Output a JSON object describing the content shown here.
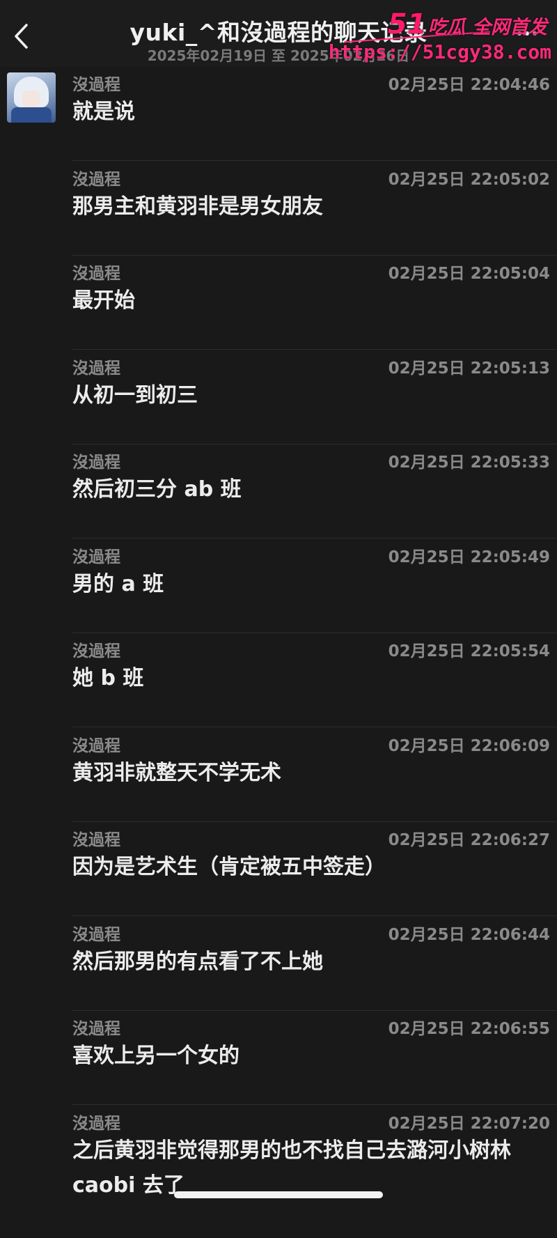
{
  "header": {
    "title": "yuki_^和沒過程的聊天记录",
    "date_range": "2025年02月19日 至 2025年02月26日"
  },
  "watermark": {
    "logo_num": "51",
    "logo_text": "吃瓜 全网首发",
    "url": "https://51cgy38.com"
  },
  "messages": [
    {
      "sender": "沒過程",
      "time": "02月25日 22:04:46",
      "text": "就是说"
    },
    {
      "sender": "沒過程",
      "time": "02月25日 22:05:02",
      "text": "那男主和黄羽非是男女朋友"
    },
    {
      "sender": "沒過程",
      "time": "02月25日 22:05:04",
      "text": "最开始"
    },
    {
      "sender": "沒過程",
      "time": "02月25日 22:05:13",
      "text": "从初一到初三"
    },
    {
      "sender": "沒過程",
      "time": "02月25日 22:05:33",
      "text": "然后初三分 ab 班"
    },
    {
      "sender": "沒過程",
      "time": "02月25日 22:05:49",
      "text": "男的 a 班"
    },
    {
      "sender": "沒過程",
      "time": "02月25日 22:05:54",
      "text": "她 b 班"
    },
    {
      "sender": "沒過程",
      "time": "02月25日 22:06:09",
      "text": "黄羽非就整天不学无术"
    },
    {
      "sender": "沒過程",
      "time": "02月25日 22:06:27",
      "text": "因为是艺术生（肯定被五中签走）"
    },
    {
      "sender": "沒過程",
      "time": "02月25日 22:06:44",
      "text": "然后那男的有点看了不上她"
    },
    {
      "sender": "沒過程",
      "time": "02月25日 22:06:55",
      "text": "喜欢上另一个女的"
    },
    {
      "sender": "沒過程",
      "time": "02月25日 22:07:20",
      "text": "之后黄羽非觉得那男的也不找自己去潞河小树林 caobi 去了"
    }
  ]
}
